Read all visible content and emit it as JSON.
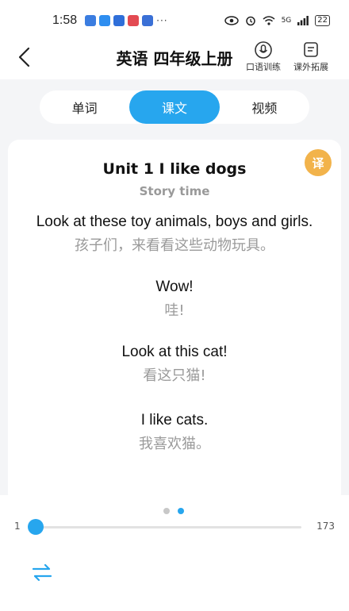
{
  "status_bar": {
    "time": "1:58",
    "more": "···",
    "network": "5G",
    "battery": "22"
  },
  "header": {
    "title": "英语 四年级上册",
    "speak_label": "口语训练",
    "extra_label": "课外拓展"
  },
  "tabs": [
    {
      "label": "单词",
      "active": false
    },
    {
      "label": "课文",
      "active": true
    },
    {
      "label": "视频",
      "active": false
    }
  ],
  "content": {
    "translate_badge": "译",
    "unit_title": "Unit 1 I like dogs",
    "section_title": "Story time",
    "lines": [
      {
        "en": "Look at these toy animals, boys and girls.",
        "zh": "孩子们，来看看这些动物玩具。"
      },
      {
        "en": "Wow!",
        "zh": "哇!"
      },
      {
        "en": "Look at this cat!",
        "zh": "看这只猫!"
      },
      {
        "en": "I like cats.",
        "zh": "我喜欢猫。"
      }
    ]
  },
  "player": {
    "page_index": 2,
    "page_count": 2,
    "range_min": "1",
    "range_max": "173",
    "position": 1
  },
  "colors": {
    "accent": "#27a6ee",
    "badge": "#f2b34b"
  }
}
